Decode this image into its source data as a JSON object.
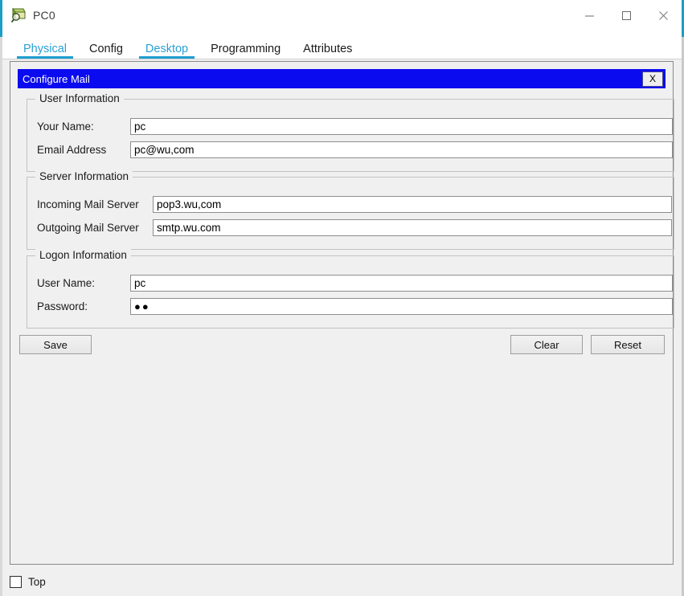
{
  "window": {
    "title": "PC0",
    "icon": "pc-device-icon",
    "controls": [
      {
        "name": "minimize-button",
        "glyph": "–"
      },
      {
        "name": "maximize-button",
        "glyph": "□"
      },
      {
        "name": "close-button",
        "glyph": "✕"
      }
    ],
    "accent_color": "#1c9fc4"
  },
  "tabs": [
    {
      "label": "Physical",
      "active": true
    },
    {
      "label": "Config",
      "active": false
    },
    {
      "label": "Desktop",
      "active": true
    },
    {
      "label": "Programming",
      "active": false
    },
    {
      "label": "Attributes",
      "active": false
    }
  ],
  "dialog": {
    "title": "Configure Mail",
    "title_bar_color": "#0b0bf0",
    "close_label": "X"
  },
  "groups": {
    "user": {
      "title": "User Information",
      "fields": [
        {
          "label": "Your Name:",
          "value": "pc"
        },
        {
          "label": "Email Address",
          "value": "pc@wu,com"
        }
      ]
    },
    "server": {
      "title": "Server Information",
      "fields": [
        {
          "label": "Incoming Mail Server",
          "value": "pop3.wu,com"
        },
        {
          "label": "Outgoing Mail Server",
          "value": "smtp.wu.com"
        }
      ]
    },
    "logon": {
      "title": "Logon Information",
      "fields": [
        {
          "label": "User Name:",
          "value": "pc"
        },
        {
          "label": "Password:",
          "value": "●●"
        }
      ]
    }
  },
  "buttons": {
    "save": "Save",
    "clear": "Clear",
    "reset": "Reset"
  },
  "bottom": {
    "top_label": "Top",
    "top_checked": false
  }
}
